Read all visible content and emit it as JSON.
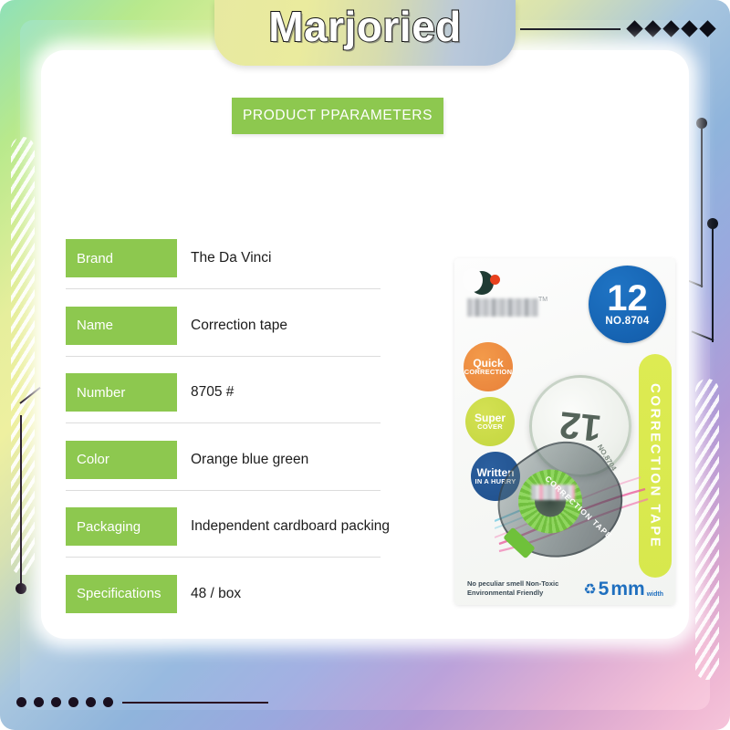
{
  "header": {
    "brand_title": "Marjoried",
    "diamond_count": 5,
    "dot_count": 6
  },
  "banner": {
    "label": "PRODUCT PPARAMETERS",
    "color": "#8dc84f"
  },
  "spec_table": {
    "rows": [
      {
        "key": "Brand",
        "value": "The Da Vinci"
      },
      {
        "key": "Name",
        "value": "Correction tape"
      },
      {
        "key": "Number",
        "value": "8705 #"
      },
      {
        "key": "Color",
        "value": "Orange blue green"
      },
      {
        "key": "Packaging",
        "value": "Independent cardboard packing"
      },
      {
        "key": "Specifications",
        "value": "48 / box"
      }
    ]
  },
  "product_package": {
    "badge_number": "12",
    "badge_model": "NO.8704",
    "side_label": "CORRECTION TAPE",
    "dial_number": "12",
    "dial_model": "NO.8704",
    "tape_label": "CORRECTION TAPE",
    "logo_trademark": "TM",
    "feature_badges": [
      {
        "line1": "Quick",
        "line2": "CORRECTION",
        "color": "#e8813a"
      },
      {
        "line1": "Super",
        "line2": "COVER",
        "color": "#c3d63f"
      },
      {
        "line1": "Written",
        "line2": "IN A HURRY",
        "color": "#1f4f8c"
      }
    ],
    "bottom_note_line1": "No peculiar smell Non-Toxic",
    "bottom_note_line2": "Environmental Friendly",
    "recycle_icon": "recycle-symbol",
    "width_value": "5",
    "width_unit": "mm",
    "width_label": "width"
  },
  "theme": {
    "green": "#8dc84f",
    "blue": "#1765b4",
    "yellow_green": "#d7e84d"
  }
}
